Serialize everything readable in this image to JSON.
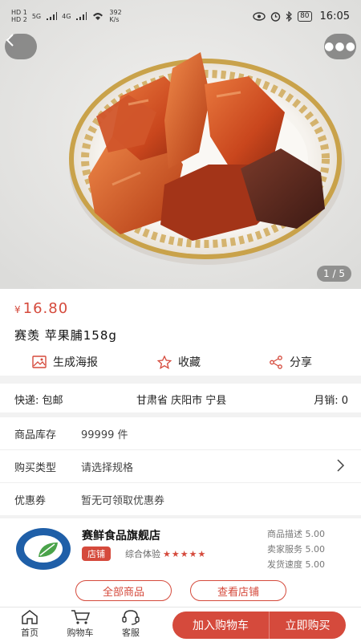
{
  "status_bar": {
    "left_badges": [
      "HD 1",
      "HD 2"
    ],
    "signal_labels": [
      "5G",
      "4G"
    ],
    "net_speed": "392",
    "net_unit": "K/s",
    "battery": "80",
    "time": "16:05"
  },
  "gallery": {
    "counter": "1 / 5"
  },
  "product": {
    "currency": "¥",
    "price": "16.80",
    "title": "赛羡 苹果脯158g"
  },
  "actions": {
    "poster": "生成海报",
    "favorite": "收藏",
    "share": "分享"
  },
  "shipping": {
    "express": "快递: 包邮",
    "location": "甘肃省 庆阳市 宁县",
    "monthly_sales": "月销: 0"
  },
  "details": [
    {
      "label": "商品库存",
      "value": "99999 件"
    },
    {
      "label": "购买类型",
      "value": "请选择规格"
    },
    {
      "label": "优惠券",
      "value": "暂无可领取优惠券"
    }
  ],
  "store": {
    "name": "赛鲜食品旗舰店",
    "tag": "店铺",
    "overall_label": "综合体验",
    "stars": "★★★★★",
    "rating_stars": 5,
    "scores": [
      "商品描述 5.00",
      "卖家服务 5.00",
      "发货速度 5.00"
    ],
    "all_products": "全部商品",
    "view_store": "查看店铺"
  },
  "bottom_bar": {
    "home": "首页",
    "cart": "购物车",
    "service": "客服",
    "add_to_cart": "加入购物车",
    "buy_now": "立即购买"
  },
  "colors": {
    "accent": "#d54a3c"
  }
}
